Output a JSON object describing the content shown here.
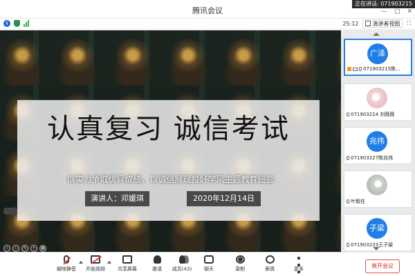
{
  "window": {
    "title": "腾讯会议",
    "speaking_banner": "正在讲话: 071903215",
    "controls": {
      "minimize": "—",
      "maximize": "□",
      "close": "✕"
    }
  },
  "info_bar": {
    "timer": "25:12",
    "view_mode": "演讲者视图",
    "icons": [
      "info-icon",
      "shield-icon",
      "signal-icon",
      "fullscreen-icon"
    ]
  },
  "slide": {
    "title": "认真复习  诚信考试",
    "subtitle": "以实力争取优异成绩，以诚信展现良好学风主题教育班会",
    "speaker": "演讲人：邓媛琪",
    "date": "2020年12月14日"
  },
  "participants": [
    {
      "avatar_text": "广泽",
      "name": "071903215陈...",
      "active": true,
      "avatar_style": "blue"
    },
    {
      "avatar_text": "",
      "name": "071903214 刘薇薇",
      "active": false,
      "avatar_style": "photo-a"
    },
    {
      "avatar_text": "兆伟",
      "name": "071903227陈兆伟",
      "active": false,
      "avatar_style": "blue"
    },
    {
      "avatar_text": "",
      "name": "叶毅在",
      "active": false,
      "avatar_style": "photo-b"
    },
    {
      "avatar_text": "子粱",
      "name": "071903233王子粱",
      "active": false,
      "avatar_style": "blue"
    }
  ],
  "toolbar": {
    "unmute": "解除静音",
    "start_video": "开始视频",
    "share_screen": "共享屏幕",
    "invite": "邀请",
    "members": "成员(43)",
    "chat": "聊天",
    "record": "录制",
    "reactions": "表情",
    "more": "更多",
    "leave": "离开会议"
  },
  "colors": {
    "accent_blue": "#1f7ee8",
    "leave_red": "#e02f2f",
    "mute_red": "#e23c3c"
  }
}
